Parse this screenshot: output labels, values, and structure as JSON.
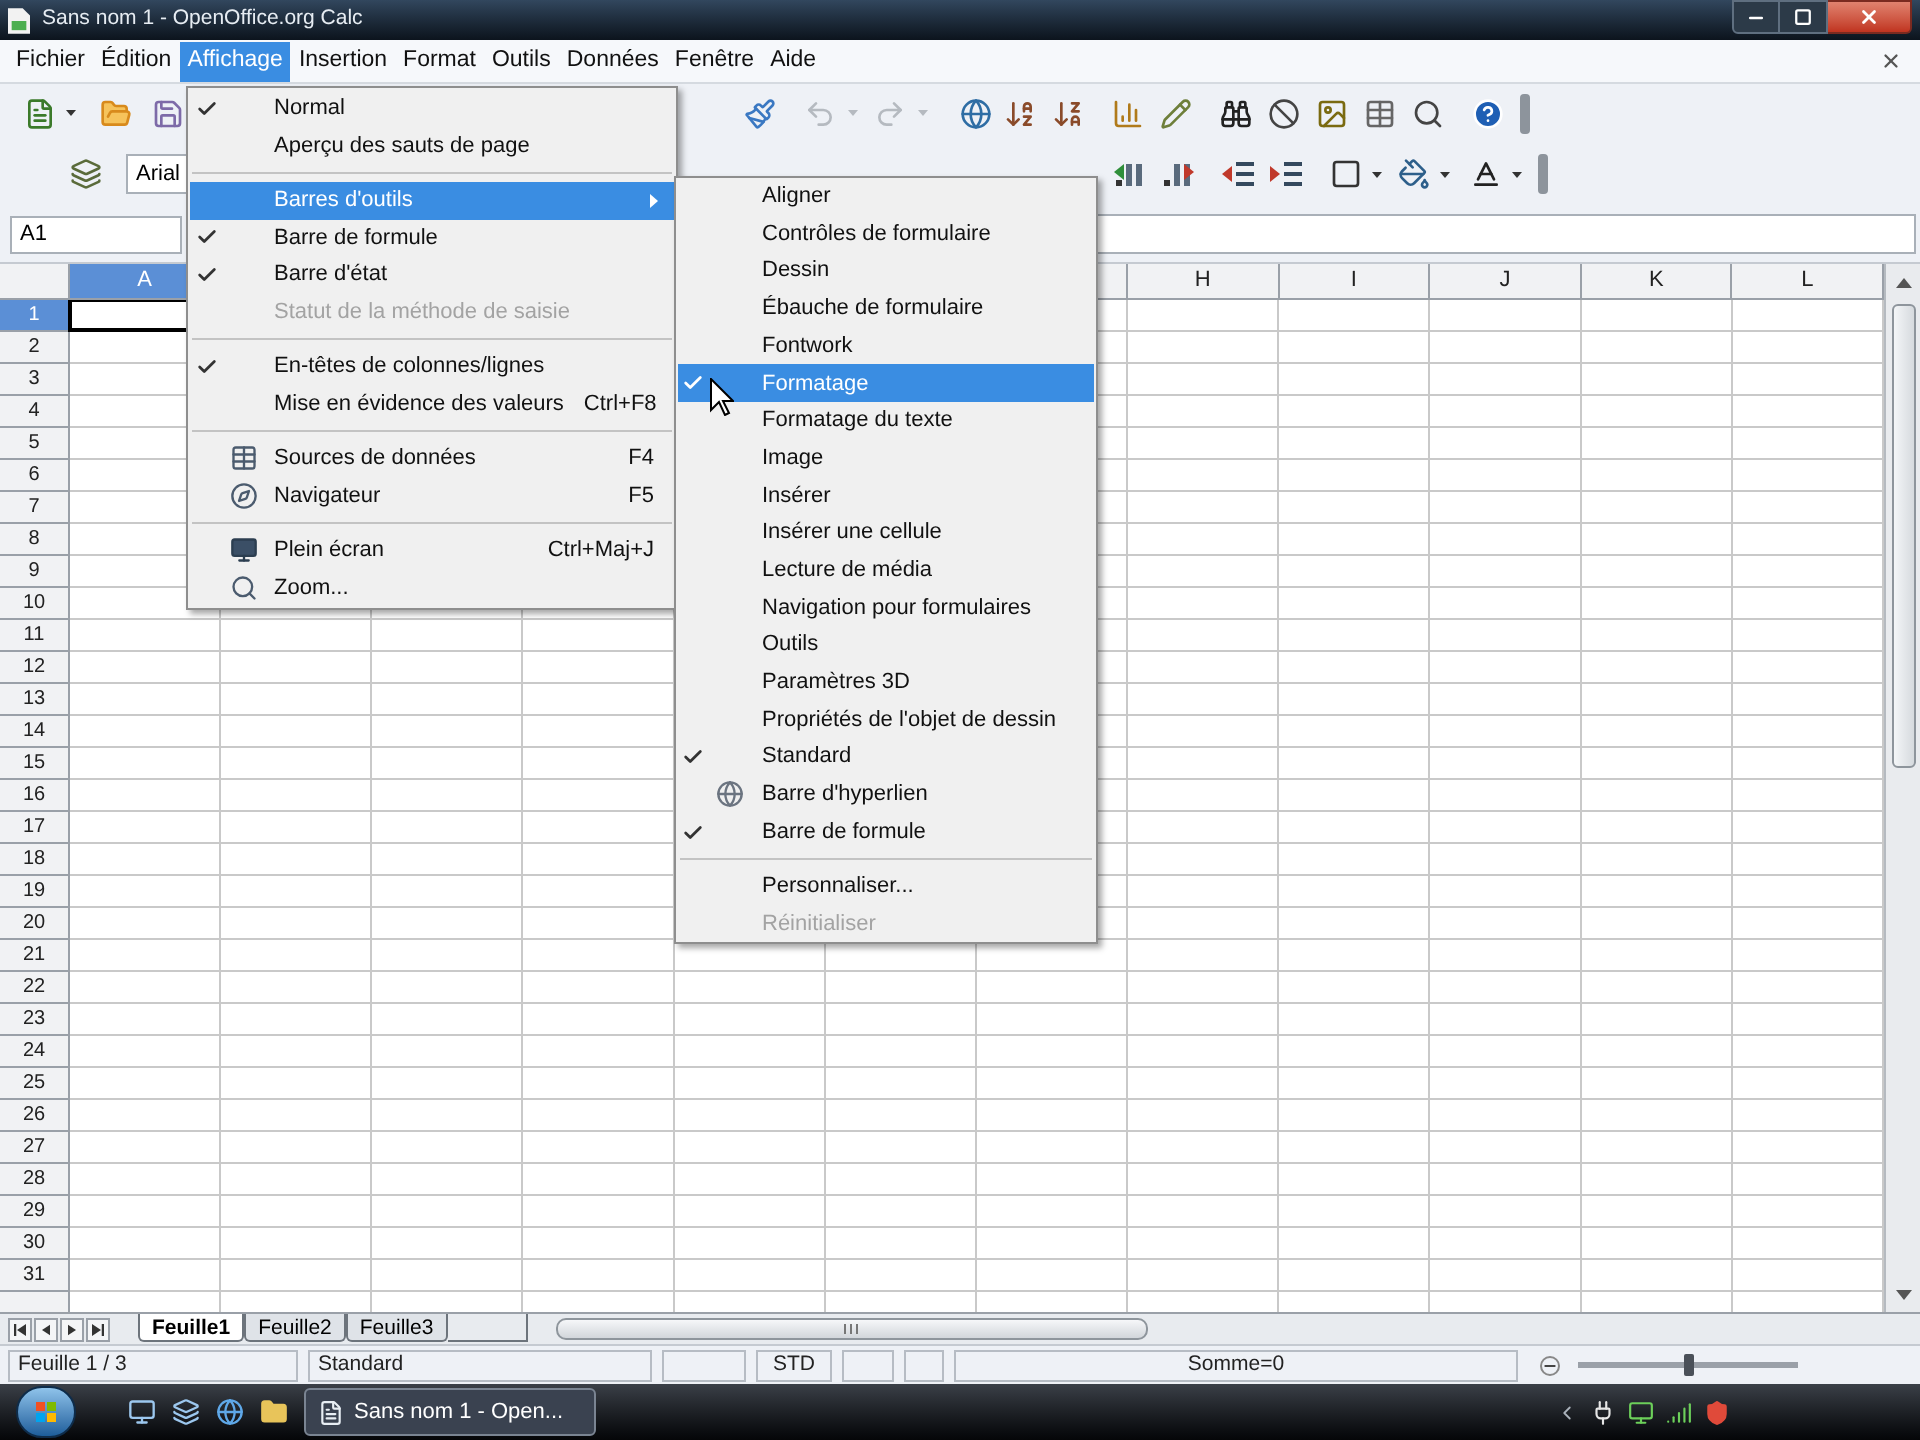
{
  "window": {
    "title": "Sans nom 1 - OpenOffice.org Calc"
  },
  "menu_bar": [
    {
      "label": "Fichier",
      "selected": false
    },
    {
      "label": "Édition",
      "selected": false
    },
    {
      "label": "Affichage",
      "selected": true
    },
    {
      "label": "Insertion",
      "selected": false
    },
    {
      "label": "Format",
      "selected": false
    },
    {
      "label": "Outils",
      "selected": false
    },
    {
      "label": "Données",
      "selected": false
    },
    {
      "label": "Fenêtre",
      "selected": false
    },
    {
      "label": "Aide",
      "selected": false
    }
  ],
  "formatting_toolbar": {
    "font_name": "Arial"
  },
  "formula_bar": {
    "name_box": "A1"
  },
  "columns": [
    {
      "label": "A",
      "selected": true
    },
    {
      "label": "H",
      "selected": false
    },
    {
      "label": "I",
      "selected": false
    },
    {
      "label": "J",
      "selected": false
    },
    {
      "label": "K",
      "selected": false
    },
    {
      "label": "L",
      "selected": false
    }
  ],
  "rows": [
    {
      "label": "1",
      "selected": true
    },
    {
      "label": "2",
      "selected": false
    },
    {
      "label": "3",
      "selected": false
    },
    {
      "label": "4",
      "selected": false
    },
    {
      "label": "5",
      "selected": false
    },
    {
      "label": "6",
      "selected": false
    },
    {
      "label": "7",
      "selected": false
    },
    {
      "label": "8",
      "selected": false
    },
    {
      "label": "9",
      "selected": false
    },
    {
      "label": "10",
      "selected": false
    },
    {
      "label": "11",
      "selected": false
    },
    {
      "label": "12",
      "selected": false
    },
    {
      "label": "13",
      "selected": false
    },
    {
      "label": "14",
      "selected": false
    },
    {
      "label": "15",
      "selected": false
    },
    {
      "label": "16",
      "selected": false
    },
    {
      "label": "17",
      "selected": false
    },
    {
      "label": "18",
      "selected": false
    },
    {
      "label": "19",
      "selected": false
    },
    {
      "label": "20",
      "selected": false
    },
    {
      "label": "21",
      "selected": false
    },
    {
      "label": "22",
      "selected": false
    },
    {
      "label": "23",
      "selected": false
    },
    {
      "label": "24",
      "selected": false
    },
    {
      "label": "25",
      "selected": false
    },
    {
      "label": "26",
      "selected": false
    },
    {
      "label": "27",
      "selected": false
    },
    {
      "label": "28",
      "selected": false
    },
    {
      "label": "29",
      "selected": false
    },
    {
      "label": "30",
      "selected": false
    },
    {
      "label": "31",
      "selected": false
    }
  ],
  "view_menu": {
    "items": [
      {
        "kind": "item",
        "label": "Normal",
        "checked": true,
        "selected": false,
        "disabled": false
      },
      {
        "kind": "item",
        "label": "Aperçu des sauts de page",
        "checked": false,
        "selected": false,
        "disabled": false
      },
      {
        "kind": "separator"
      },
      {
        "kind": "submenu",
        "label": "Barres d'outils",
        "checked": false,
        "selected": true,
        "disabled": false
      },
      {
        "kind": "item",
        "label": "Barre de formule",
        "checked": true,
        "selected": false,
        "disabled": false
      },
      {
        "kind": "item",
        "label": "Barre d'état",
        "checked": true,
        "selected": false,
        "disabled": false
      },
      {
        "kind": "item",
        "label": "Statut de la méthode de saisie",
        "checked": false,
        "selected": false,
        "disabled": true
      },
      {
        "kind": "separator"
      },
      {
        "kind": "item",
        "label": "En-têtes de colonnes/lignes",
        "checked": true,
        "selected": false,
        "disabled": false
      },
      {
        "kind": "item",
        "label": "Mise en évidence des valeurs",
        "shortcut": "Ctrl+F8",
        "checked": false,
        "selected": false,
        "disabled": false
      },
      {
        "kind": "separator"
      },
      {
        "kind": "item",
        "label": "Sources de données",
        "shortcut": "F4",
        "checked": false,
        "selected": false,
        "disabled": false
      },
      {
        "kind": "item",
        "label": "Navigateur",
        "shortcut": "F5",
        "checked": false,
        "selected": false,
        "disabled": false
      },
      {
        "kind": "separator"
      },
      {
        "kind": "item",
        "label": "Plein écran",
        "shortcut": "Ctrl+Maj+J",
        "checked": false,
        "selected": false,
        "disabled": false
      },
      {
        "kind": "item",
        "label": "Zoom...",
        "checked": false,
        "selected": false,
        "disabled": false
      }
    ]
  },
  "toolbars_submenu": {
    "items": [
      {
        "kind": "item",
        "label": "Aligner",
        "checked": false,
        "selected": false,
        "disabled": false
      },
      {
        "kind": "item",
        "label": "Contrôles de formulaire",
        "checked": false,
        "selected": false,
        "disabled": false
      },
      {
        "kind": "item",
        "label": "Dessin",
        "checked": false,
        "selected": false,
        "disabled": false
      },
      {
        "kind": "item",
        "label": "Ébauche de formulaire",
        "checked": false,
        "selected": false,
        "disabled": false
      },
      {
        "kind": "item",
        "label": "Fontwork",
        "checked": false,
        "selected": false,
        "disabled": false
      },
      {
        "kind": "item",
        "label": "Formatage",
        "checked": true,
        "selected": true,
        "disabled": false
      },
      {
        "kind": "item",
        "label": "Formatage du texte",
        "checked": false,
        "selected": false,
        "disabled": false
      },
      {
        "kind": "item",
        "label": "Image",
        "checked": false,
        "selected": false,
        "disabled": false
      },
      {
        "kind": "item",
        "label": "Insérer",
        "checked": false,
        "selected": false,
        "disabled": false
      },
      {
        "kind": "item",
        "label": "Insérer une cellule",
        "checked": false,
        "selected": false,
        "disabled": false
      },
      {
        "kind": "item",
        "label": "Lecture de média",
        "checked": false,
        "selected": false,
        "disabled": false
      },
      {
        "kind": "item",
        "label": "Navigation pour formulaires",
        "checked": false,
        "selected": false,
        "disabled": false
      },
      {
        "kind": "item",
        "label": "Outils",
        "checked": false,
        "selected": false,
        "disabled": false
      },
      {
        "kind": "item",
        "label": "Paramètres 3D",
        "checked": false,
        "selected": false,
        "disabled": false
      },
      {
        "kind": "item",
        "label": "Propriétés de l'objet de dessin",
        "checked": false,
        "selected": false,
        "disabled": false
      },
      {
        "kind": "item",
        "label": "Standard",
        "checked": true,
        "selected": false,
        "disabled": false
      },
      {
        "kind": "item",
        "label": "Barre d'hyperlien",
        "checked": false,
        "selected": false,
        "disabled": false
      },
      {
        "kind": "item",
        "label": "Barre de formule",
        "checked": true,
        "selected": false,
        "disabled": false
      },
      {
        "kind": "separator"
      },
      {
        "kind": "item",
        "label": "Personnaliser...",
        "checked": false,
        "selected": false,
        "disabled": false
      },
      {
        "kind": "item",
        "label": "Réinitialiser",
        "checked": false,
        "selected": false,
        "disabled": true
      }
    ]
  },
  "sheet_tabs": [
    {
      "label": "Feuille1",
      "selected": true
    },
    {
      "label": "Feuille2",
      "selected": false
    },
    {
      "label": "Feuille3",
      "selected": false
    }
  ],
  "status_bar": {
    "sheet": "Feuille 1 / 3",
    "page_style": "Standard",
    "selection_mode": "STD",
    "sum": "Somme=0",
    "zoom": {
      "level": 0.5
    }
  },
  "taskbar": {
    "windows": [
      {
        "label": "Sans nom 1 - Open...",
        "selected": true
      }
    ]
  }
}
